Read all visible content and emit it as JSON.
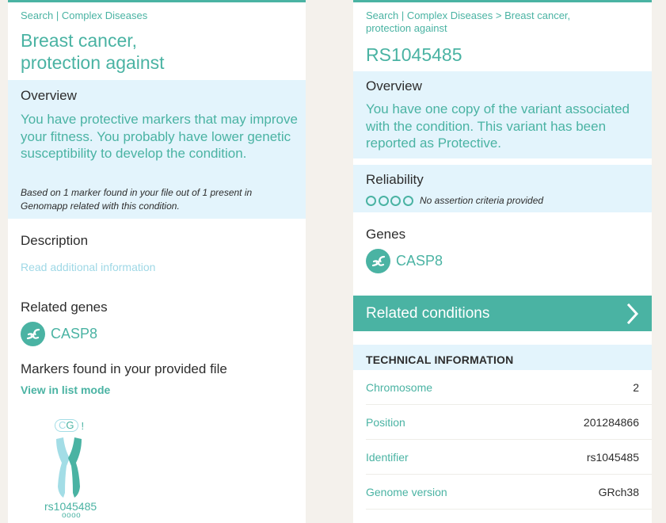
{
  "colors": {
    "accent": "#4ab3a3",
    "light_accent": "#a3dde6",
    "info_background": "#e3f4fc",
    "page_background": "#f4f1ec"
  },
  "left": {
    "breadcrumb": {
      "search": "Search",
      "separator": "|",
      "section": "Complex Diseases"
    },
    "title_line1": "Breast cancer,",
    "title_line2": "protection against",
    "overview": {
      "heading": "Overview",
      "text": "You have protective markers that may improve your fitness. You probably have lower genetic susceptibility to develop the condition.",
      "note": "Based on 1 marker found in your file out of 1 present in Genomapp related with this condition."
    },
    "description": {
      "heading": "Description",
      "link": "Read additional information"
    },
    "related_genes": {
      "heading": "Related genes",
      "genes": [
        {
          "name": "CASP8",
          "icon": "dna-icon"
        }
      ]
    },
    "markers": {
      "heading": "Markers found in your provided file",
      "list_link": "View in list mode",
      "items": [
        {
          "alleles": [
            "C",
            "G"
          ],
          "flag": "!",
          "id": "rs1045485",
          "reliability_dots": "oooo",
          "icon": "chromosome-icon"
        }
      ]
    }
  },
  "right": {
    "breadcrumb": {
      "search": "Search",
      "separator": "|",
      "section": "Complex Diseases",
      "arrow": ">",
      "condition_line1": "Breast cancer,",
      "condition_line2": "protection against"
    },
    "title": "RS1045485",
    "overview": {
      "heading": "Overview",
      "text": "You have one copy of the variant associated with the condition. This variant has been reported as Protective."
    },
    "reliability": {
      "heading": "Reliability",
      "stars_filled": 0,
      "stars_total": 4,
      "text": "No assertion criteria provided"
    },
    "genes": {
      "heading": "Genes",
      "items": [
        {
          "name": "CASP8",
          "icon": "dna-icon"
        }
      ]
    },
    "related_conditions": {
      "label": "Related conditions",
      "icon": "chevron-right-icon"
    },
    "technical": {
      "heading": "TECHNICAL INFORMATION",
      "rows": [
        {
          "key": "Chromosome",
          "value": "2"
        },
        {
          "key": "Position",
          "value": "201284866"
        },
        {
          "key": "Identifier",
          "value": "rs1045485"
        },
        {
          "key": "Genome version",
          "value": "GRch38"
        }
      ]
    }
  }
}
